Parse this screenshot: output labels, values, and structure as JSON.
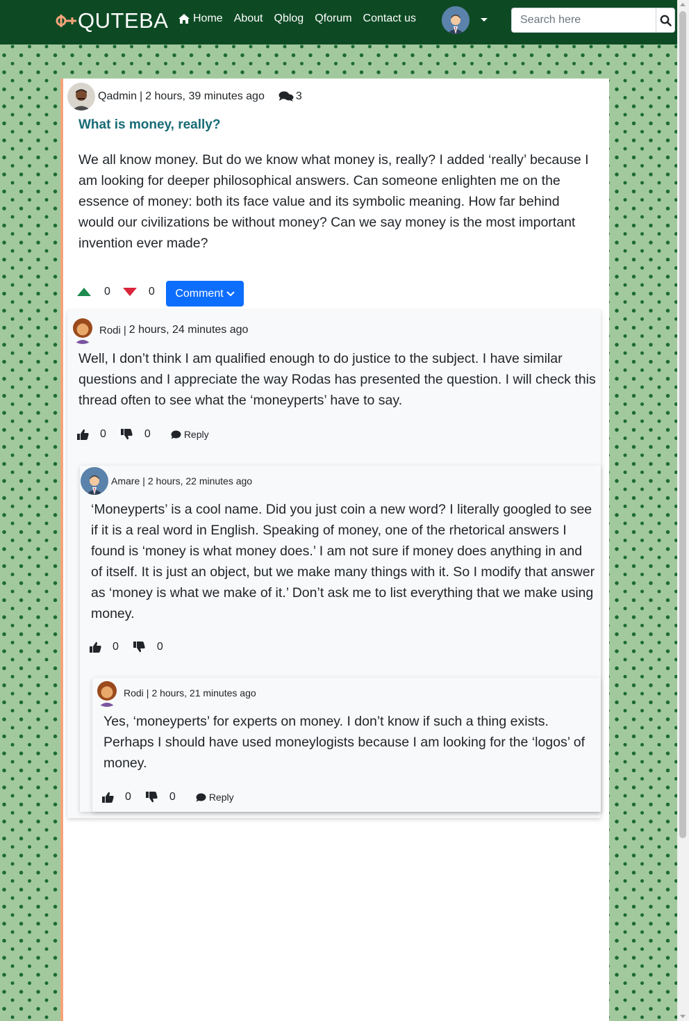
{
  "nav": {
    "brand": "QUTEBA",
    "links": [
      "Home",
      "About",
      "Qblog",
      "Qforum",
      "Contact us"
    ],
    "search_placeholder": "Search here"
  },
  "question": {
    "author": "Qadmin",
    "time": "2 hours, 39 minutes ago",
    "comment_count": "3",
    "title": "What is money, really?",
    "body": "We all know money. But do we know what money is, really? I added ‘really’ because I am looking for deeper philosophical answers. Can someone enlighten me on the essence of money: both its face value and its symbolic meaning. How far behind would our civilizations be without money? Can we say money is the most important invention ever made?",
    "upvotes": "0",
    "downvotes": "0",
    "comment_button": "Comment"
  },
  "comments": [
    {
      "author": "Rodi",
      "time": "2 hours, 24 minutes ago",
      "body": "Well, I don’t think I am qualified enough to do justice to the subject. I have similar questions and I appreciate the way Rodas has presented the question. I will check this thread often to see what the ‘moneyperts’ have to say.",
      "likes": "0",
      "dislikes": "0",
      "reply_label": "Reply"
    },
    {
      "author": "Amare",
      "time": "2 hours, 22 minutes ago",
      "body": "‘Moneyperts’ is a cool name. Did you just coin a new word? I literally googled to see if it is a real word in English. Speaking of money, one of the rhetorical answers I found is ‘money is what money does.’ I am not sure if money does anything in and of itself. It is just an object, but we make many things with it. So I modify that answer as ‘money is what we make of it.’ Don’t ask me to list everything that we make using money.",
      "likes": "0",
      "dislikes": "0"
    },
    {
      "author": "Rodi",
      "time": "2 hours, 21 minutes ago",
      "body": "Yes, ‘moneyperts’ for experts on money. I don’t know if such a thing exists. Perhaps I should have used moneylogists because I am looking for the ‘logos’ of money.",
      "likes": "0",
      "dislikes": "0",
      "reply_label": "Reply"
    }
  ],
  "colors": {
    "navbar": "#0d4a24",
    "background": "#a2c99e",
    "pattern": "#1c6a35",
    "title": "#176b75",
    "comment_button": "#0d6efd",
    "card_border": "#f4a47a",
    "upvote": "#1d8a4e",
    "downvote": "#d9263b"
  },
  "icons": [
    "home-icon",
    "search-icon",
    "comments-icon",
    "thumbs-up-icon",
    "thumbs-down-icon",
    "reply-icon",
    "chevron-down-icon"
  ]
}
